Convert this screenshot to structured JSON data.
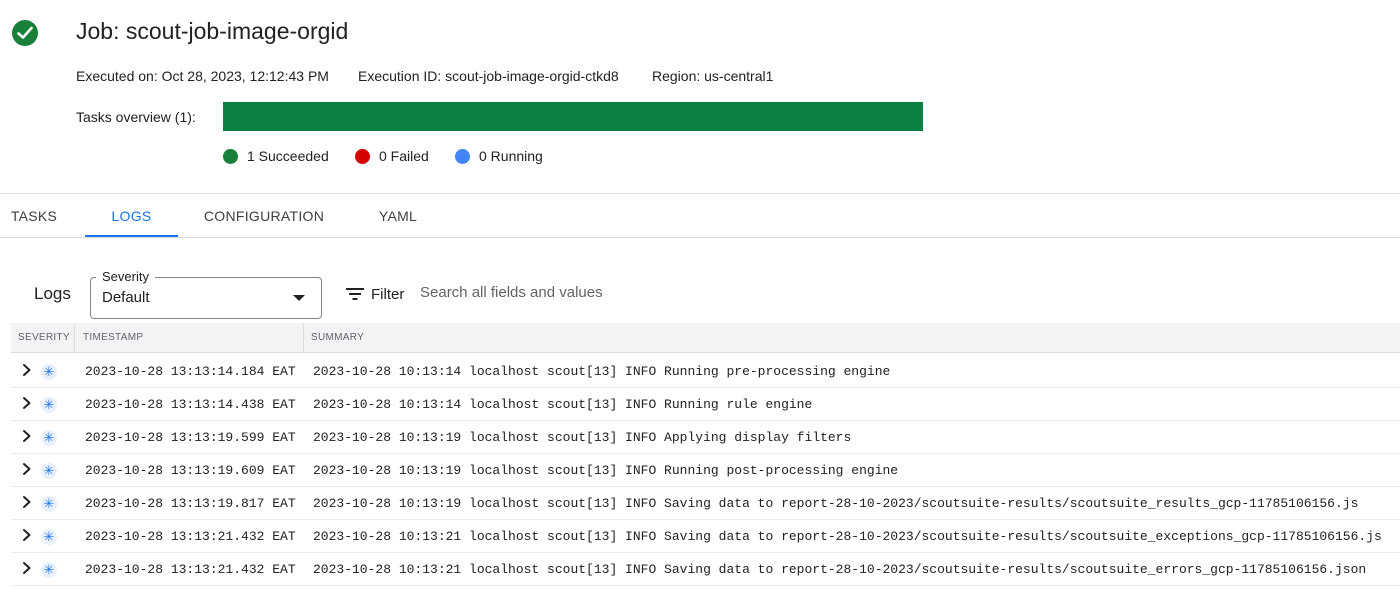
{
  "job": {
    "title": "Job: scout-job-image-orgid",
    "executed_on": "Executed on: Oct 28, 2023, 12:12:43 PM",
    "execution_id": "Execution ID: scout-job-image-orgid-ctkd8",
    "region": "Region: us-central1",
    "status_icon": "check-circle-icon",
    "status_color": "#188038"
  },
  "tasks_overview": {
    "label": "Tasks overview (1):",
    "succeeded_fraction": 1.0,
    "bar_color": "#0b8043",
    "legend": [
      {
        "label": "1 Succeeded",
        "color": "#188038"
      },
      {
        "label": "0 Failed",
        "color": "#d50000"
      },
      {
        "label": "0 Running",
        "color": "#4285f4"
      }
    ]
  },
  "tabs": [
    {
      "label": "TASKS",
      "active": false
    },
    {
      "label": "LOGS",
      "active": true
    },
    {
      "label": "CONFIGURATION",
      "active": false
    },
    {
      "label": "YAML",
      "active": false
    }
  ],
  "logs": {
    "heading": "Logs",
    "severity_label": "Severity",
    "severity_value": "Default",
    "filter_label": "Filter",
    "filter_placeholder": "Search all fields and values",
    "columns": [
      "SEVERITY",
      "TIMESTAMP",
      "SUMMARY"
    ],
    "rows": [
      {
        "timestamp": "2023-10-28 13:13:14.184 EAT",
        "summary": "2023-10-28 10:13:14 localhost scout[13] INFO Running pre-processing engine"
      },
      {
        "timestamp": "2023-10-28 13:13:14.438 EAT",
        "summary": "2023-10-28 10:13:14 localhost scout[13] INFO Running rule engine"
      },
      {
        "timestamp": "2023-10-28 13:13:19.599 EAT",
        "summary": "2023-10-28 10:13:19 localhost scout[13] INFO Applying display filters"
      },
      {
        "timestamp": "2023-10-28 13:13:19.609 EAT",
        "summary": "2023-10-28 10:13:19 localhost scout[13] INFO Running post-processing engine"
      },
      {
        "timestamp": "2023-10-28 13:13:19.817 EAT",
        "summary": "2023-10-28 10:13:19 localhost scout[13] INFO Saving data to report-28-10-2023/scoutsuite-results/scoutsuite_results_gcp-11785106156.js"
      },
      {
        "timestamp": "2023-10-28 13:13:21.432 EAT",
        "summary": "2023-10-28 10:13:21 localhost scout[13] INFO Saving data to report-28-10-2023/scoutsuite-results/scoutsuite_exceptions_gcp-11785106156.js"
      },
      {
        "timestamp": "2023-10-28 13:13:21.432 EAT",
        "summary": "2023-10-28 10:13:21 localhost scout[13] INFO Saving data to report-28-10-2023/scoutsuite-results/scoutsuite_errors_gcp-11785106156.json"
      }
    ],
    "severity_icon": "default-severity-icon",
    "accent_color": "#1a73e8"
  }
}
